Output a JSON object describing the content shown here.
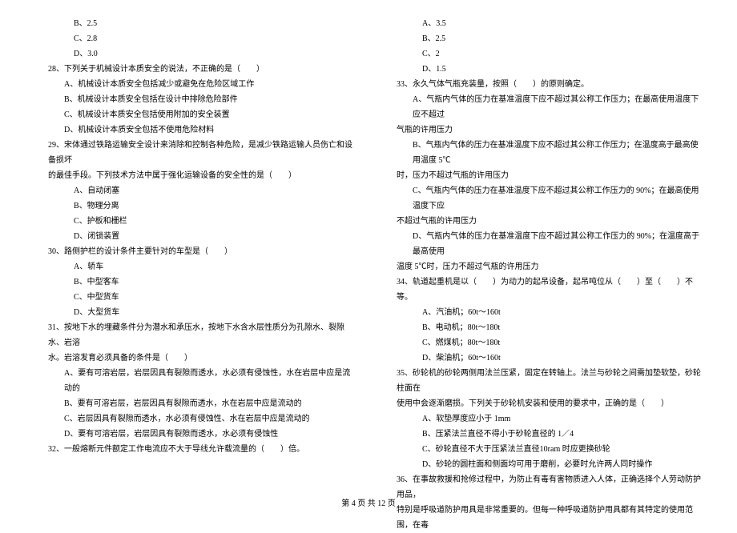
{
  "left_column": {
    "q27_options": [
      "B、2.5",
      "C、2.8",
      "D、3.0"
    ],
    "q28": {
      "text": "28、下列关于机械设计本质安全的说法，不正确的是（　　）",
      "options": [
        "A、机械设计本质安全包括减少或避免在危险区域工作",
        "B、机械设计本质安全包括在设计中排除危险部件",
        "C、机械设计本质安全包括使用附加的安全装置",
        "D、机械设计本质安全包括不使用危险材料"
      ]
    },
    "q29": {
      "text": "29、宋体通过铁路运输安全设计来消除和控制各种危险，是减少铁路运输人员伤亡和设备损坏",
      "text_cont": "的最佳手段。下列技术方法中属于强化运输设备的安全性的是（　　）",
      "options": [
        "A、自动闭塞",
        "B、物理分离",
        "C、护板和栅栏",
        "D、闭锁装置"
      ]
    },
    "q30": {
      "text": "30、路侧护栏的设计条件主要针对的车型是（　　）",
      "options": [
        "A、轿车",
        "B、中型客车",
        "C、中型货车",
        "D、大型货车"
      ]
    },
    "q31": {
      "text": "31、按地下水的埋藏条件分为潜水和承压水，按地下水含水层性质分为孔隙水、裂隙水、岩溶",
      "text_cont": "水。岩溶发育必须具备的条件是（　　）",
      "options": [
        "A、要有可溶岩层，岩层因具有裂隙而透水，水必须有侵蚀性，水在岩层中应是流动的",
        "B、要有可溶岩层，岩层因具有裂隙而透水，水在岩层中应是流动的",
        "C、岩层因具有裂隙而透水，水必须有侵蚀性、水在岩层中应是流动的",
        "D、要有可溶岩层，岩层因具有裂隙而透水，水必须有侵蚀性"
      ]
    },
    "q32": {
      "text": "32、一般熔断元件额定工作电流应不大于导线允许载流量的（　　）倍。"
    }
  },
  "right_column": {
    "q32_options": [
      "A、3.5",
      "B、2.5",
      "C、2",
      "D、1.5"
    ],
    "q33": {
      "text": "33、永久气体气瓶充装量，按照（　　）的原则确定。",
      "options": [
        "A、气瓶内气体的压力在基准温度下应不超过其公称工作压力；在最高使用温度下应不超过",
        "气瓶的许用压力",
        "B、气瓶内气体的压力在基准温度下应不超过其公称工作压力；在温度高于最高使用温度 5℃",
        "时，压力不超过气瓶的许用压力",
        "C、气瓶内气体的压力在基准温度下应不超过其公称工作压力的 90%；在最高使用温度下应",
        "不超过气瓶的许用压力",
        "D、气瓶内气体的压力在基准温度下应不超过其公称工作压力的 90%；在温度高于最高使用",
        "温度 5℃时，压力不超过气瓶的许用压力"
      ]
    },
    "q34": {
      "text": "34、轨道起重机是以（　　）为动力的起吊设备，起吊吨位从（　　）至（　　）不等。",
      "options": [
        "A、汽油机；60t～160t",
        "B、电动机；80t～180t",
        "C、燃煤机；80t～180t",
        "D、柴油机；60t～160t"
      ]
    },
    "q35": {
      "text": "35、砂轮机的砂轮两侧用法兰压紧，固定在转轴上。法兰与砂轮之间需加垫软垫，砂轮柱面在",
      "text_cont": "使用中会逐渐磨损。下列关于砂轮机安装和使用的要求中，正确的是（　　）",
      "options": [
        "A、软垫厚度应小于 1mm",
        "B、压紧法兰直径不得小于砂轮直径的 1／4",
        "C、砂轮直径不大于压紧法兰直径10ram 时应更换砂轮",
        "D、砂轮的圆柱面和侧面均可用于磨削，必要时允许两人同时操作"
      ]
    },
    "q36": {
      "text": "36、在事故救援和抢修过程中，为防止有毒有害物质进入人体，正确选择个人劳动防护用品，",
      "text_cont": "特别是呼吸道防护用具是非常重要的。但每一种呼吸道防护用具都有其特定的使用范围，在毒"
    }
  },
  "footer": "第 4 页 共 12 页"
}
